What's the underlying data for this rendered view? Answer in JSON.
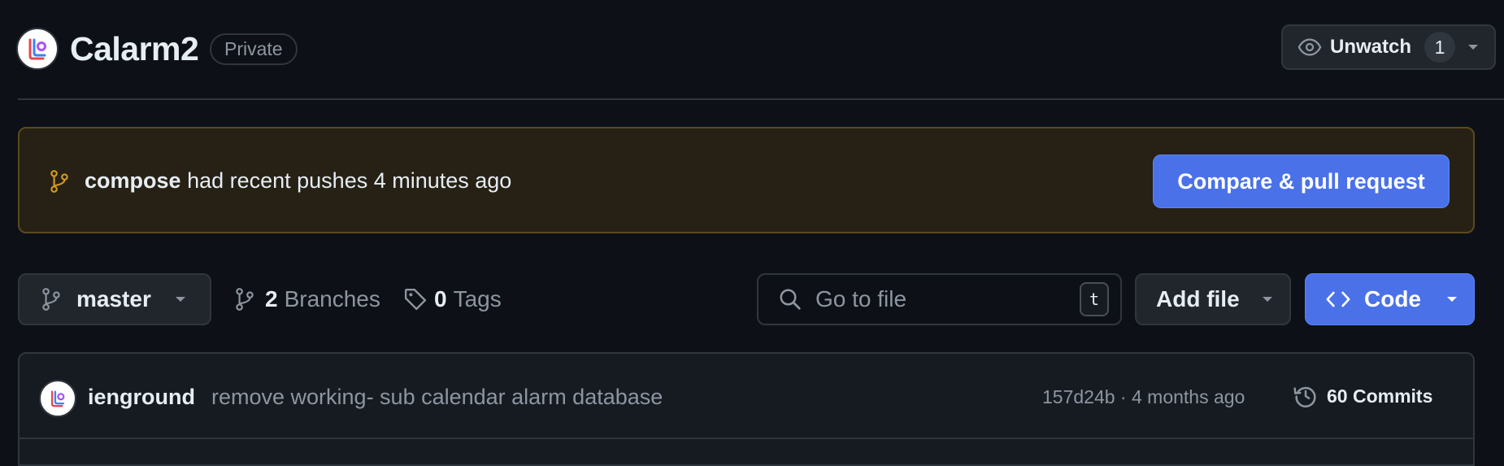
{
  "repo": {
    "name": "Calarm2",
    "visibility": "Private"
  },
  "watch": {
    "label": "Unwatch",
    "count": "1"
  },
  "banner": {
    "branch": "compose",
    "message": "had recent pushes 4 minutes ago",
    "button_label": "Compare & pull request"
  },
  "toolbar": {
    "current_branch": "master",
    "branches_count": "2",
    "branches_label": "Branches",
    "tags_count": "0",
    "tags_label": "Tags",
    "search_placeholder": "Go to file",
    "search_shortcut": "t",
    "add_file_label": "Add file",
    "code_label": "Code"
  },
  "latest_commit": {
    "author": "ienground",
    "message": "remove working- sub calendar alarm database",
    "meta": "157d24b · 4 months ago",
    "commits_label": "60 Commits"
  },
  "colors": {
    "background": "#0d1117",
    "accent_button": "#4a71e8",
    "banner_bg": "#272115",
    "banner_border": "#5b4a1e",
    "branch_icon": "#d29922"
  }
}
